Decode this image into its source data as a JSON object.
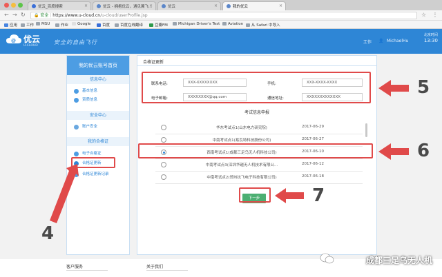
{
  "browser": {
    "tabs": [
      {
        "label": "优云_百度搜索",
        "active": false
      },
      {
        "label": "优云 - 拥抱优云，遇见翼飞...",
        "active": false
      },
      {
        "label": "优云",
        "active": false
      },
      {
        "label": "我的优云",
        "active": true
      }
    ],
    "url": {
      "secure_label": "安全",
      "host": "https://www.u-cloud.cn",
      "path": "/u-cloud/userProfile.jsp"
    },
    "bookmarks": [
      "应用",
      "工作",
      "MSU",
      "作业",
      "Google",
      "百度",
      "百度在线翻译",
      "豆瓣FM",
      "Michigan Driver's Test",
      "Aviation",
      "从 Safari 中导入"
    ]
  },
  "header": {
    "logo_text": "优云",
    "logo_sub": "U-CLOUD",
    "slogan": "安全的自由飞行",
    "nav": [
      "工作",
      "MichaelHu"
    ],
    "time_lines": [
      "北京时间",
      "13:30"
    ]
  },
  "sidebar": {
    "title": "我的优云账号首页",
    "sections": [
      {
        "title": "信息中心",
        "items": [
          "基本信息",
          "资质信息"
        ]
      },
      {
        "title": "安全中心",
        "items": [
          "账户安全"
        ]
      },
      {
        "title": "我的合格证",
        "items": [
          "电子合格证",
          "合格证更新",
          "合格证更新记录"
        ]
      }
    ]
  },
  "content": {
    "title": "合格证更新",
    "form": {
      "contact_label": "联系电话:",
      "contact_value": "XXX-XXXXXXXX",
      "mobile_label": "手机:",
      "mobile_value": "XXX-XXXX-XXXX",
      "email_label": "电子邮箱:",
      "email_value": "XXXXXXXX@qq.com",
      "address_label": "通信地址:",
      "address_value": "XXXXXXXXXXXXX"
    },
    "exam_title": "考试信息申报",
    "sites": [
      {
        "name": "华东考试点1(山东电力研究院)",
        "date": "2017-06-29",
        "selected": false
      },
      {
        "name": "中南考试点1(易瓦特科技股份公司)",
        "date": "2017-06-27",
        "selected": false
      },
      {
        "name": "西南考试点1(成都三足乌无人机科技公司)",
        "date": "2017-06-10",
        "selected": true
      },
      {
        "name": "中南考试点3(深圳华越无人机技术有限公...",
        "date": "2017-06-12",
        "selected": false
      },
      {
        "name": "中南考试点2(郑州抗飞电子科技有限公司)",
        "date": "2017-06-18",
        "selected": false
      }
    ],
    "next_label": "下一步"
  },
  "annotations": {
    "n4": "4",
    "n5": "5",
    "n6": "6",
    "n7": "7"
  },
  "footer": {
    "col1": "客户服务",
    "col2": "关于我们"
  },
  "watermark": "成都三足乌无人机",
  "colors": {
    "brand": "#2e86d6",
    "annotation": "#e04a4a",
    "next_button": "#4caf72"
  }
}
